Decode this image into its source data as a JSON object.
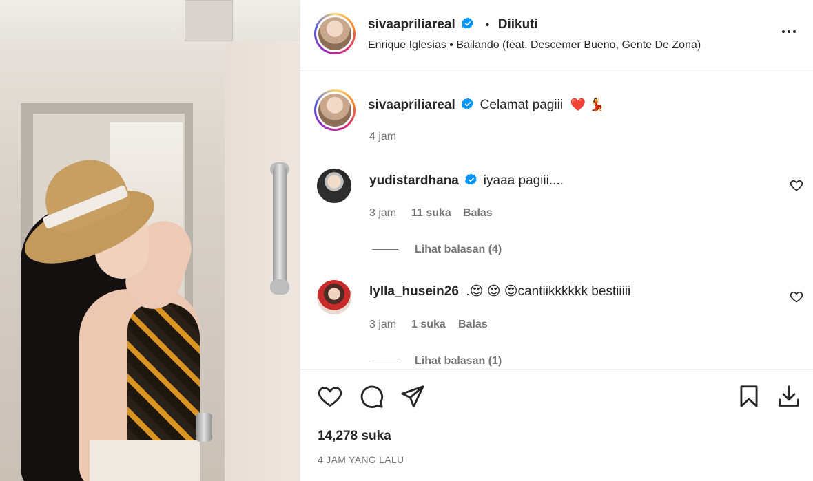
{
  "post": {
    "author": "sivaapriliareal",
    "follow_status": "Diikuti",
    "separator": "•",
    "audio": "Enrique Iglesias • Bailando (feat. Descemer Bueno, Gente De Zona)"
  },
  "caption": {
    "username": "sivaapriliareal",
    "text": "Celamat pagiii",
    "emoji": "❤️ 💃",
    "time": "4 jam"
  },
  "comments": [
    {
      "username": "yudistardhana",
      "verified": true,
      "text": "iyaaa pagiii....",
      "time": "3 jam",
      "likes": "11 suka",
      "reply_label": "Balas",
      "view_replies": "Lihat balasan (4)"
    },
    {
      "username": "lylla_husein26",
      "verified": false,
      "text": ".😍 😍 😍cantiikkkkkk bestiiiii",
      "time": "3 jam",
      "likes": "1 suka",
      "reply_label": "Balas",
      "view_replies": "Lihat balasan (1)"
    }
  ],
  "footer": {
    "likes": "14,278 suka",
    "timestamp": "4 JAM YANG LALU"
  },
  "icons": {
    "like": "heart-icon",
    "comment": "comment-icon",
    "share": "share-icon",
    "save": "bookmark-icon",
    "download": "download-icon",
    "more": "more-options-icon",
    "verified": "verified-badge-icon"
  },
  "colors": {
    "verified": "#0095f6",
    "text": "#262626",
    "secondary": "#737373",
    "divider": "#efefef"
  }
}
